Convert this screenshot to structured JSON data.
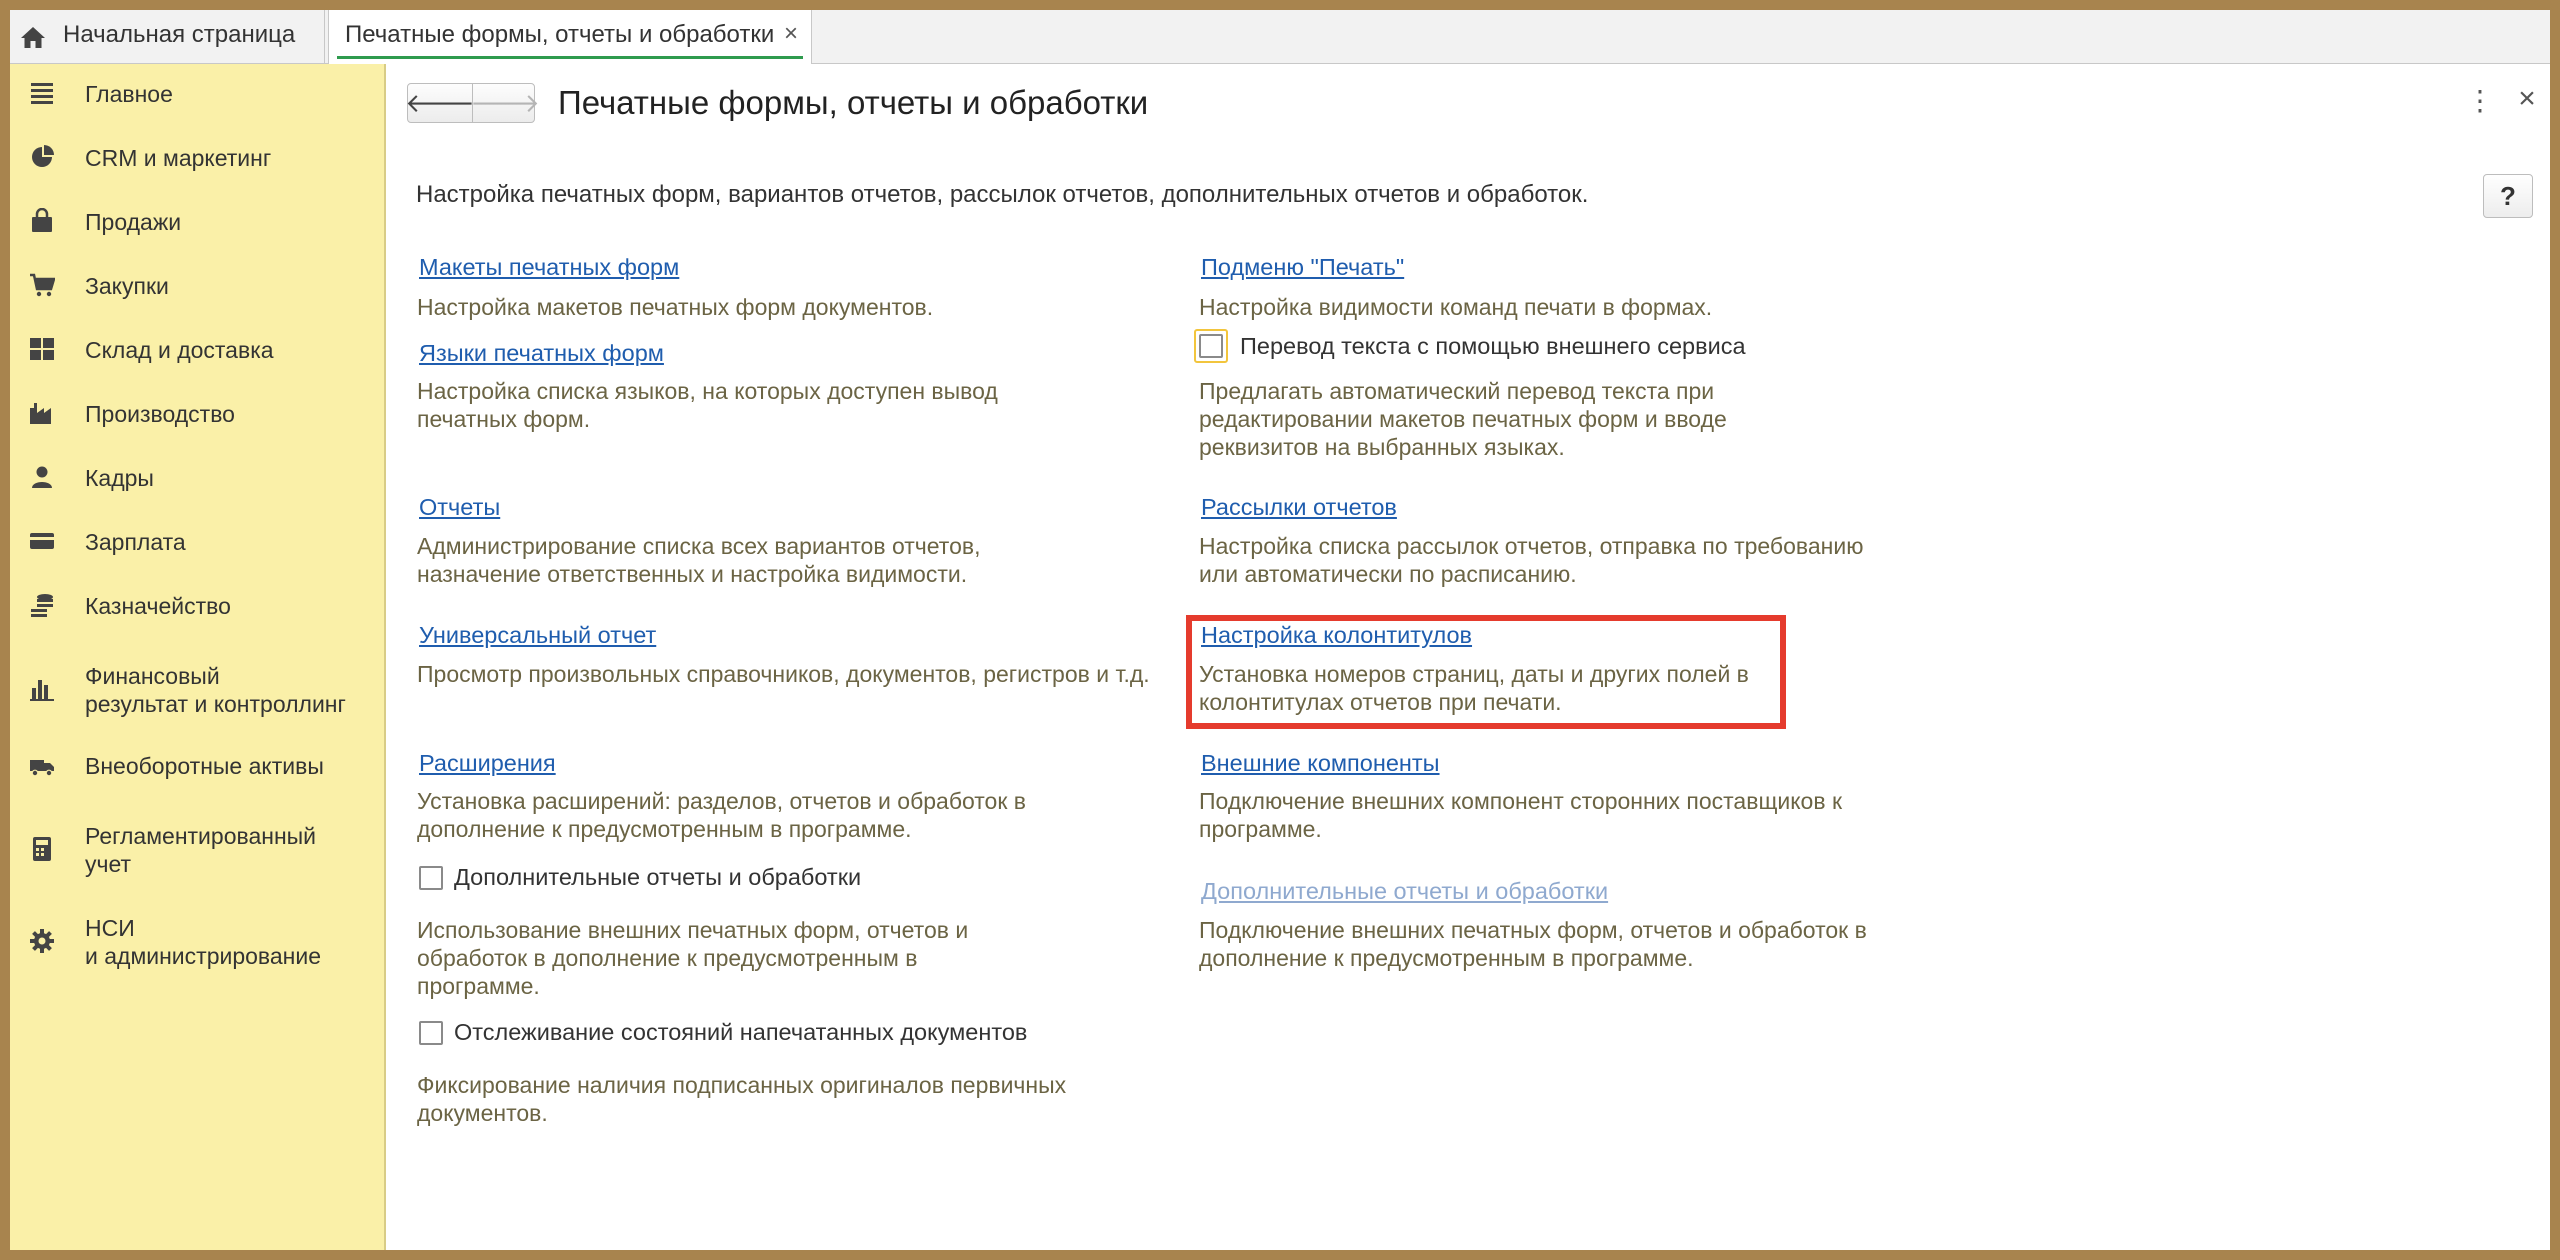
{
  "tabs": {
    "home": {
      "label": "Начальная страница",
      "icon": "home-icon"
    },
    "active": {
      "label": "Печатные формы, отчеты и обработки",
      "close": "×"
    }
  },
  "sidebar": {
    "items": [
      {
        "label": "Главное",
        "icon": "menu-lines-icon"
      },
      {
        "label": "CRM и маркетинг",
        "icon": "pie-chart-icon"
      },
      {
        "label": "Продажи",
        "icon": "shopping-bag-icon"
      },
      {
        "label": "Закупки",
        "icon": "shopping-cart-icon"
      },
      {
        "label": "Склад и доставка",
        "icon": "warehouse-grid-icon"
      },
      {
        "label": "Производство",
        "icon": "factory-icon"
      },
      {
        "label": "Кадры",
        "icon": "person-icon"
      },
      {
        "label": "Зарплата",
        "icon": "wallet-card-icon"
      },
      {
        "label": "Казначейство",
        "icon": "coins-stack-icon"
      },
      {
        "label": "Финансовый\nрезультат и контроллинг",
        "icon": "bar-chart-icon"
      },
      {
        "label": "Внеоборотные активы",
        "icon": "truck-icon"
      },
      {
        "label": "Регламентированный\nучет",
        "icon": "calculator-icon"
      },
      {
        "label": "НСИ\nи администрирование",
        "icon": "gear-icon"
      }
    ]
  },
  "header": {
    "title": "Печатные формы, отчеты и обработки",
    "back": "🡐",
    "forward": "🡒",
    "more": "⋮",
    "close": "×",
    "help": "?"
  },
  "intro": "Настройка печатных форм, вариантов отчетов, рассылок отчетов, дополнительных отчетов и обработок.",
  "left": {
    "print_layouts": {
      "link": "Макеты печатных форм",
      "desc": "Настройка макетов печатных форм документов."
    },
    "print_languages": {
      "link": "Языки печатных форм",
      "desc": "Настройка списка языков, на которых доступен вывод\nпечатных форм."
    },
    "reports": {
      "link": "Отчеты",
      "desc": "Администрирование списка всех вариантов отчетов,\nназначение ответственных и настройка видимости."
    },
    "universal_report": {
      "link": "Универсальный отчет",
      "desc": "Просмотр произвольных справочников, документов, регистров и т.д."
    },
    "extensions": {
      "link": "Расширения",
      "desc": "Установка расширений: разделов, отчетов и обработок в\nдополнение к предусмотренным в программе."
    },
    "additional_reports": {
      "checkbox": "Дополнительные отчеты и обработки",
      "checked": false,
      "desc": "Использование внешних печатных форм, отчетов и\nобработок в дополнение к предусмотренным в\nпрограмме."
    },
    "tracking": {
      "checkbox": "Отслеживание состояний напечатанных документов",
      "checked": false,
      "desc": "Фиксирование наличия подписанных оригиналов первичных\nдокументов."
    }
  },
  "right": {
    "print_submenu": {
      "link": "Подменю \"Печать\"",
      "desc": "Настройка видимости команд печати в формах."
    },
    "translation": {
      "checkbox": "Перевод текста с помощью внешнего сервиса",
      "checked": false,
      "desc": "Предлагать автоматический перевод текста при\nредактировании макетов печатных форм и вводе\nреквизитов на выбранных языках."
    },
    "mailing": {
      "link": "Рассылки отчетов",
      "desc": "Настройка списка рассылок отчетов, отправка по требованию\nили автоматически по расписанию."
    },
    "headers_footers": {
      "link": "Настройка колонтитулов",
      "desc": "Установка номеров страниц, даты и других полей в\nколонтитулах отчетов при печати."
    },
    "external_components": {
      "link": "Внешние компоненты",
      "desc": "Подключение внешних компонент сторонних поставщиков к\nпрограмме."
    },
    "additional_reports": {
      "link": "Дополнительные отчеты и обработки",
      "desc": "Подключение внешних печатных форм, отчетов и обработок в\nдополнение к предусмотренным в программе."
    }
  },
  "colors": {
    "sidebar_bg": "#FAF0A8",
    "link": "#1F5DAE",
    "description": "#6B6444",
    "highlight": "#E53B2D",
    "tab_underline": "#2E9B4E"
  }
}
